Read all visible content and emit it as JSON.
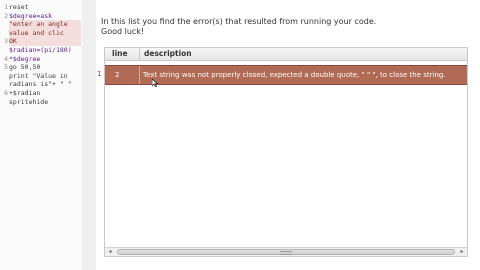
{
  "code_editor": {
    "line_numbers": [
      "1",
      "2",
      "",
      "",
      "3",
      "",
      "4",
      "5",
      "",
      "",
      "6"
    ],
    "lines": [
      {
        "text": "reset",
        "style": ""
      },
      {
        "text": "$degree=ask",
        "style": "kw"
      },
      {
        "text": "\"enter an angle",
        "style": "err"
      },
      {
        "text": "value and clic",
        "style": "err"
      },
      {
        "text": "OK",
        "style": "err"
      },
      {
        "text": "$radian=(pi/180)",
        "style": "kw"
      },
      {
        "text": "*$degree",
        "style": "kw"
      },
      {
        "text": "go 50,50",
        "style": ""
      },
      {
        "text": "print \"Value in",
        "style": ""
      },
      {
        "text": "radians is\"+ \" \"",
        "style": ""
      },
      {
        "text": "+$radian",
        "style": ""
      },
      {
        "text": "spritehide",
        "style": ""
      }
    ]
  },
  "error_pane": {
    "intro_line1": "In this list you find the error(s) that resulted from running your code.",
    "intro_line2": "Good luck!",
    "columns": {
      "line": "line",
      "description": "description"
    },
    "rows": [
      {
        "index": "1",
        "line": "2",
        "description": "Text string was not properly closed, expected a double quote, \" \" \", to close the string."
      }
    ]
  },
  "colors": {
    "error_row": "#b06a55",
    "error_code_line": "#f4dddd"
  }
}
